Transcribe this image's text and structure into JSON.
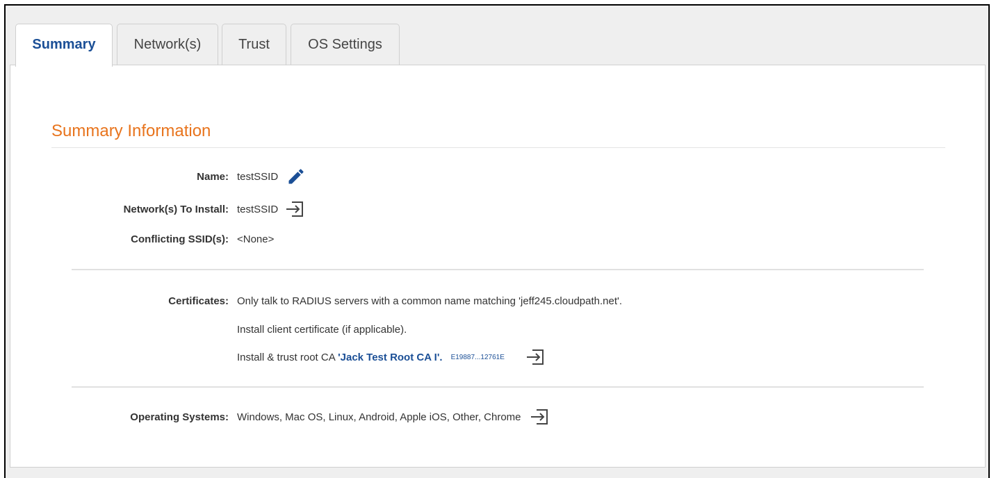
{
  "tabs": [
    {
      "label": "Summary",
      "active": true
    },
    {
      "label": "Network(s)",
      "active": false
    },
    {
      "label": "Trust",
      "active": false
    },
    {
      "label": "OS Settings",
      "active": false
    }
  ],
  "summary": {
    "title": "Summary Information",
    "name_label": "Name:",
    "name_value": "testSSID",
    "networks_label": "Network(s) To Install:",
    "networks_value": "testSSID",
    "conflicting_label": "Conflicting SSID(s):",
    "conflicting_value": "<None>"
  },
  "certificates": {
    "label": "Certificates:",
    "line1": "Only talk to RADIUS servers with a common name matching 'jeff245.cloudpath.net'.",
    "line2": "Install client certificate (if applicable).",
    "line3_prefix": "Install & trust root CA ",
    "ca_name": "'Jack Test Root CA I'",
    "line3_suffix": ".",
    "thumbprint": "E19887...12761E"
  },
  "os": {
    "label": "Operating Systems:",
    "value": "Windows, Mac OS, Linux, Android, Apple iOS, Other, Chrome"
  },
  "colors": {
    "accent": "#1b4f96",
    "section_title": "#e8741d",
    "background": "#efefef"
  },
  "icons": {
    "edit": "pencil-icon",
    "navigate": "arrow-into-box-icon"
  }
}
